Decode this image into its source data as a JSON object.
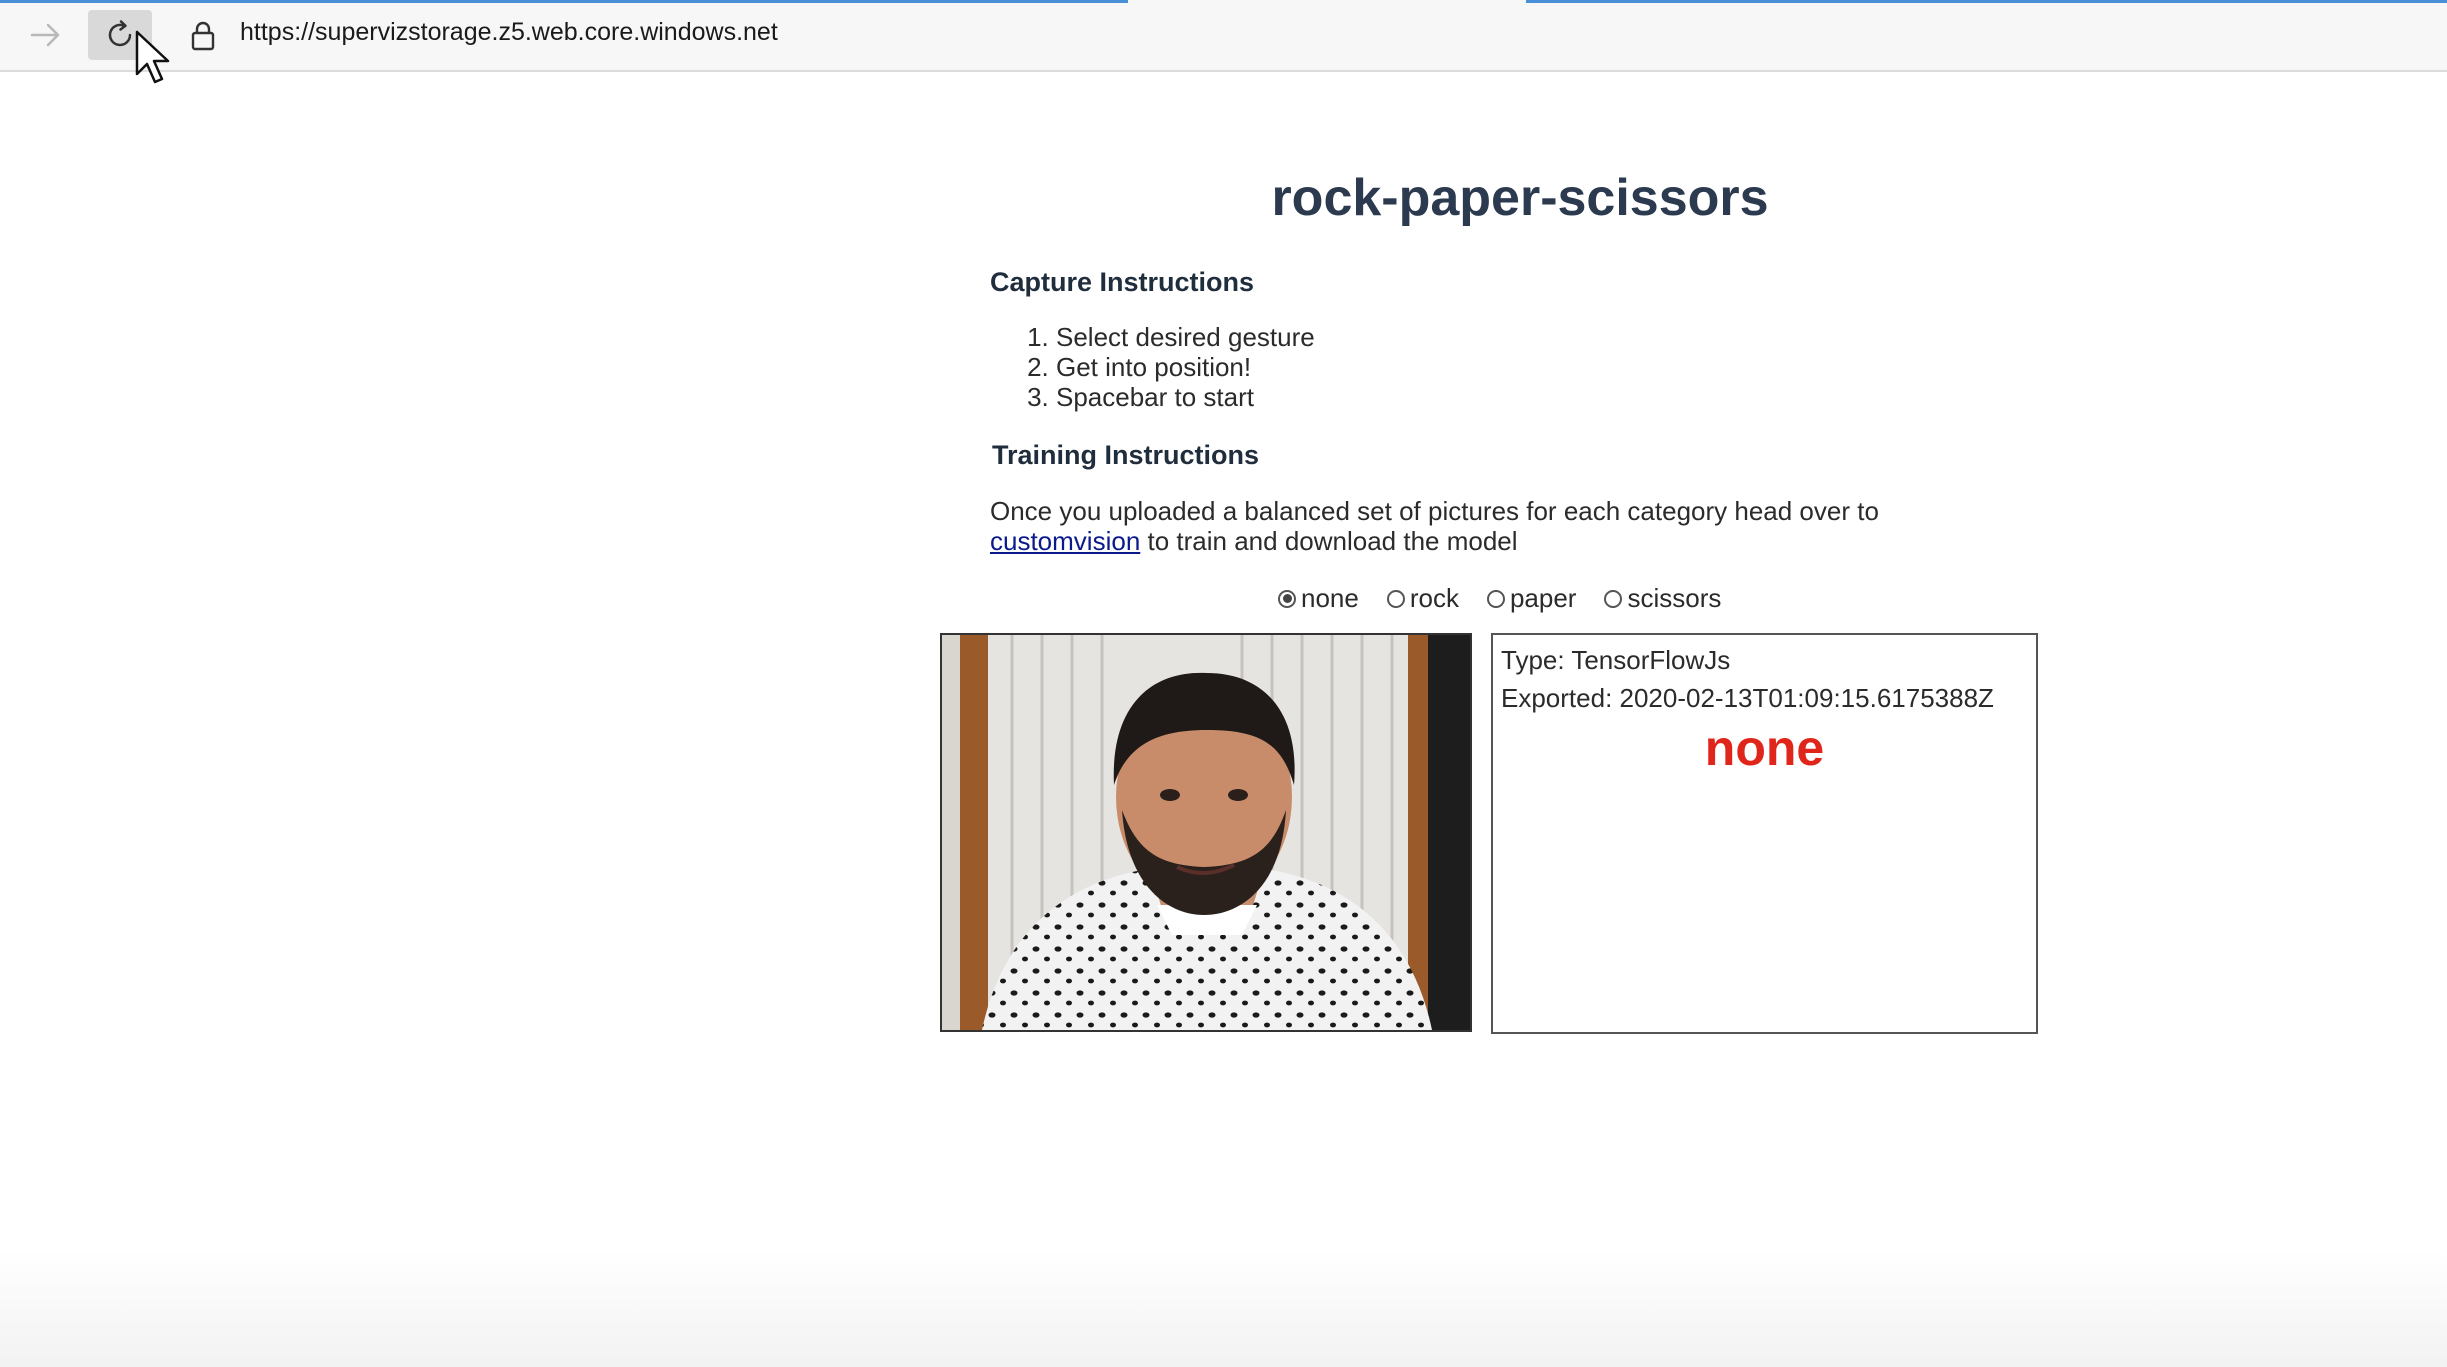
{
  "browser": {
    "url": "https://supervizstorage.z5.web.core.windows.net"
  },
  "page": {
    "title": "rock-paper-scissors",
    "capture": {
      "heading": "Capture Instructions",
      "steps": [
        "Select desired gesture",
        "Get into position!",
        "Spacebar to start"
      ]
    },
    "training": {
      "heading": "Training Instructions",
      "text_before": "Once you uploaded a balanced set of pictures for each category head over to",
      "link": "customvision",
      "text_after": "to train and download the model"
    },
    "gestures": {
      "selected": "none",
      "options": [
        "none",
        "rock",
        "paper",
        "scissors"
      ]
    },
    "model": {
      "type_line": "Type: TensorFlowJs",
      "exported_line": "Exported: 2020-02-13T01:09:15.6175388Z",
      "prediction": "none"
    }
  },
  "colors": {
    "title": "#2b3a4e",
    "prediction": "#e0261a",
    "link": "#0a1a8c"
  }
}
